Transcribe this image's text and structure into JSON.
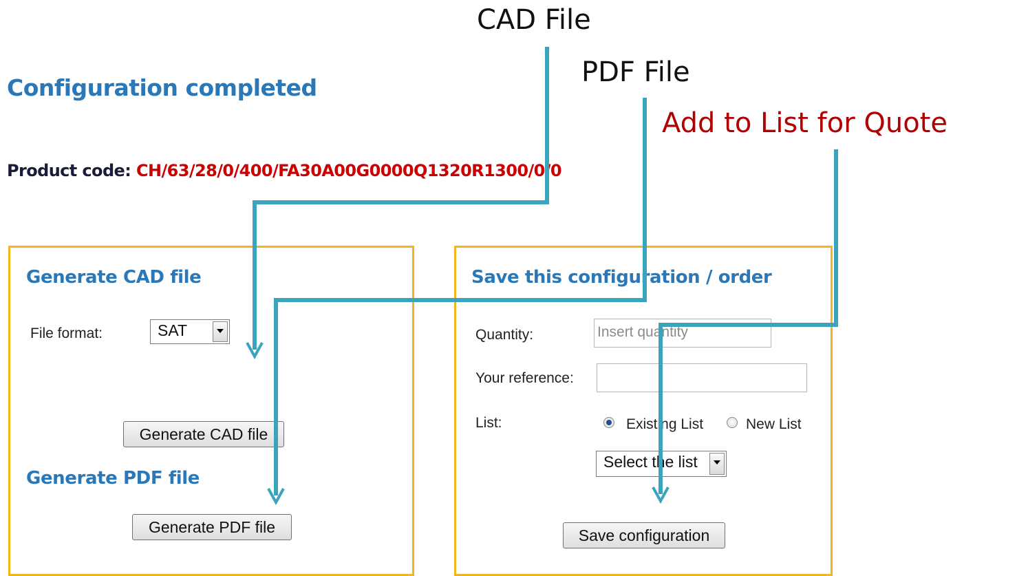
{
  "annotations": {
    "cad_file": "CAD File",
    "pdf_file": "PDF File",
    "add_to_list": "Add to List for Quote"
  },
  "page": {
    "title": "Configuration completed",
    "product_code_label": "Product code:",
    "product_code_value": "CH/63/28/0/400/FA30A00G0000Q1320R1300/0/0"
  },
  "cad_panel": {
    "title": "Generate CAD file",
    "file_format_label": "File format:",
    "file_format_value": "SAT",
    "generate_cad_button": "Generate CAD file",
    "pdf_title": "Generate PDF file",
    "generate_pdf_button": "Generate PDF file"
  },
  "save_panel": {
    "title": "Save this configuration / order",
    "quantity_label": "Quantity:",
    "quantity_placeholder": "Insert quantity",
    "reference_label": "Your reference:",
    "list_label": "List:",
    "existing_list_label": "Existing List",
    "new_list_label": "New List",
    "list_select_value": "Select the list",
    "save_button": "Save configuration"
  },
  "colors": {
    "heading_blue": "#2a78b8",
    "product_code_red": "#cc0000",
    "annotation_red": "#b00000",
    "panel_border": "#f4b41a",
    "leader_line": "#3aa3be"
  }
}
